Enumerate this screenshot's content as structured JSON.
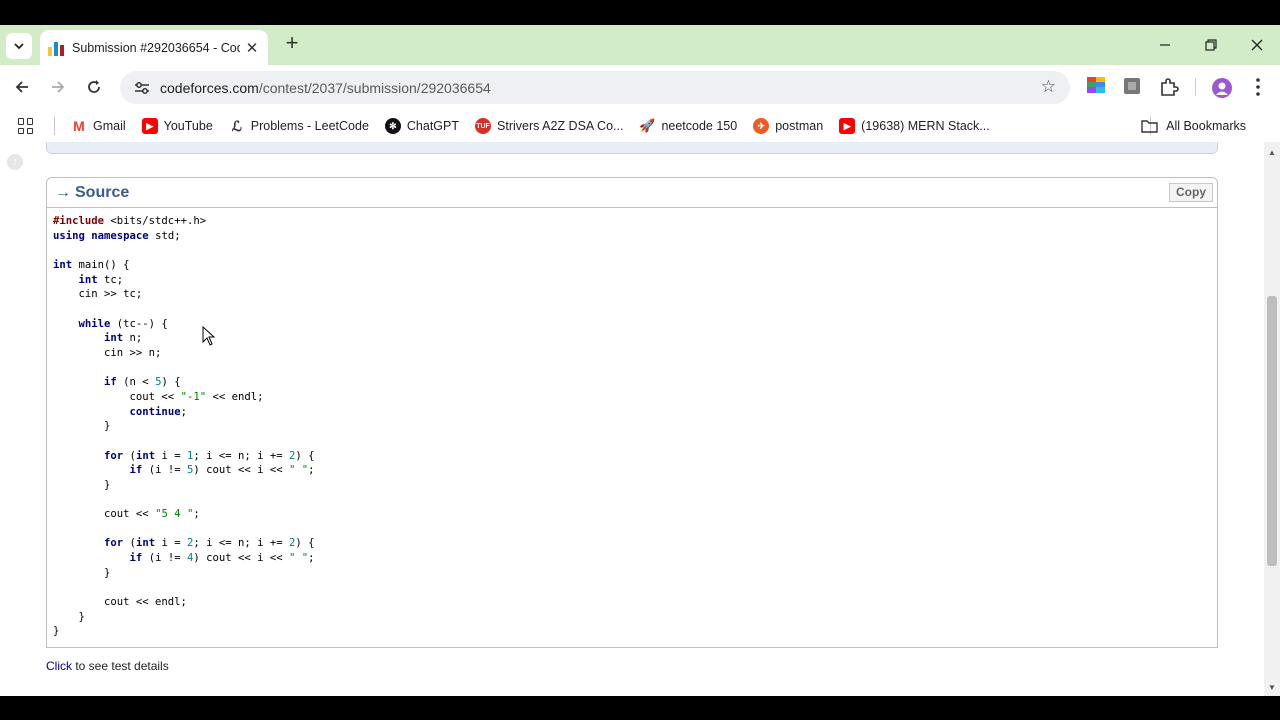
{
  "tab": {
    "title": "Submission #292036654 - Codeforces"
  },
  "address": {
    "domain": "codeforces.com",
    "path": "/contest/2037/submission/292036654"
  },
  "bookmarks": [
    {
      "label": "Gmail",
      "icon": "gmail-icon",
      "color": "#ea4335"
    },
    {
      "label": "YouTube",
      "icon": "youtube-icon",
      "color": "#ff0000"
    },
    {
      "label": "Problems - LeetCode",
      "icon": "leetcode-icon",
      "color": "#f89f1b"
    },
    {
      "label": "ChatGPT",
      "icon": "chatgpt-icon",
      "color": "#000000"
    },
    {
      "label": "Strivers A2Z DSA Co...",
      "icon": "tuf-icon",
      "color": "#d93025"
    },
    {
      "label": "neetcode 150",
      "icon": "neetcode-icon",
      "color": "#555555"
    },
    {
      "label": "postman",
      "icon": "postman-icon",
      "color": "#ef5b25"
    },
    {
      "label": "(19638) MERN Stack...",
      "icon": "youtube-icon",
      "color": "#ff0000"
    }
  ],
  "all_bookmarks": "All Bookmarks",
  "source": {
    "title": "Source",
    "copy_label": "Copy",
    "code_lines": [
      "#include <bits/stdc++.h>",
      "using namespace std;",
      "",
      "int main() {",
      "    int tc;",
      "    cin >> tc;",
      "",
      "    while (tc--) {",
      "        int n;",
      "        cin >> n;",
      "",
      "        if (n < 5) {",
      "            cout << \"-1\" << endl;",
      "            continue;",
      "        }",
      "",
      "        for (int i = 1; i <= n; i += 2) {",
      "            if (i != 5) cout << i << \" \";",
      "        }",
      "",
      "        cout << \"5 4 \";",
      "",
      "        for (int i = 2; i <= n; i += 2) {",
      "            if (i != 4) cout << i << \" \";",
      "        }",
      "",
      "        cout << endl;",
      "    }",
      "}"
    ]
  },
  "footer": {
    "link": "Click",
    "text": " to see test details"
  }
}
